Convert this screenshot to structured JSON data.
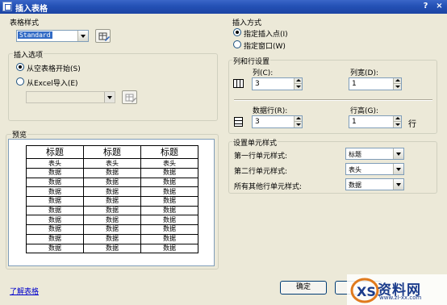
{
  "window": {
    "title": "插入表格",
    "help": "?",
    "close": "×"
  },
  "table_style": {
    "label": "表格样式",
    "selected": "Standard"
  },
  "insert_options": {
    "label": "插入选项",
    "from_empty": "从空表格开始(S)",
    "from_excel": "从Excel导入(E)",
    "excel_path": ""
  },
  "preview": {
    "label": "预览",
    "title_cells": [
      "标题",
      "标题",
      "标题"
    ],
    "header_cells": [
      "表头",
      "表头",
      "表头"
    ],
    "data_cell": "数据",
    "data_rows": 9
  },
  "insert_method": {
    "label": "插入方式",
    "point": "指定插入点(I)",
    "window": "指定窗口(W)"
  },
  "rows_cols": {
    "label": "列和行设置",
    "columns_label": "列(C):",
    "columns_value": "3",
    "col_width_label": "列宽(D):",
    "col_width_value": "1",
    "data_rows_label": "数据行(R):",
    "data_rows_value": "3",
    "row_height_label": "行高(G):",
    "row_height_value": "1",
    "row_unit": "行"
  },
  "cell_styles": {
    "label": "设置单元样式",
    "first_row_label": "第一行单元样式:",
    "first_row_value": "标题",
    "second_row_label": "第二行单元样式:",
    "second_row_value": "表头",
    "other_rows_label": "所有其他行单元样式:",
    "other_rows_value": "数据"
  },
  "footer": {
    "learn_link": "了解表格",
    "ok": "确定"
  },
  "watermark": {
    "text": "资料网",
    "url": "www.zl-xx.com"
  }
}
